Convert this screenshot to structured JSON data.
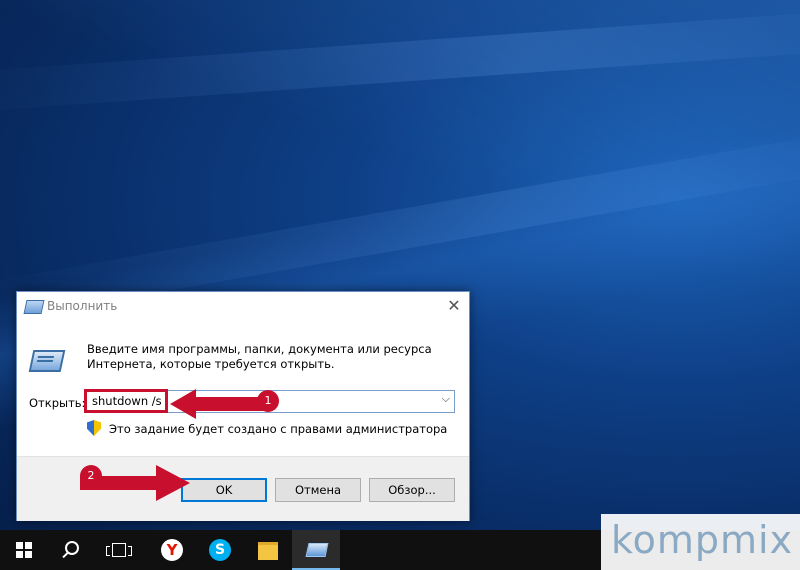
{
  "dialog": {
    "title": "Выполнить",
    "close_glyph": "✕",
    "description": "Введите имя программы, папки, документа или ресурса Интернета, которые требуется открыть.",
    "open_label": "Открыть:",
    "command_value": "shutdown /s",
    "dropdown_glyph": "⌵",
    "admin_note": "Это задание будет создано с правами администратора",
    "buttons": {
      "ok": "OK",
      "cancel": "Отмена",
      "browse": "Обзор..."
    }
  },
  "annotations": {
    "step1": "1",
    "step2": "2",
    "accent_color": "#c8102e"
  },
  "taskbar": {
    "items": [
      {
        "name": "start",
        "icon": "windows-icon"
      },
      {
        "name": "search",
        "icon": "search-icon"
      },
      {
        "name": "task-view",
        "icon": "task-view-icon"
      },
      {
        "name": "yandex",
        "icon": "yandex-browser-icon",
        "glyph": "Y"
      },
      {
        "name": "skype",
        "icon": "skype-icon",
        "glyph": "S"
      },
      {
        "name": "explorer",
        "icon": "folder-icon"
      },
      {
        "name": "run",
        "icon": "run-icon",
        "active": true
      }
    ]
  },
  "watermark": {
    "text": "kompmix"
  }
}
